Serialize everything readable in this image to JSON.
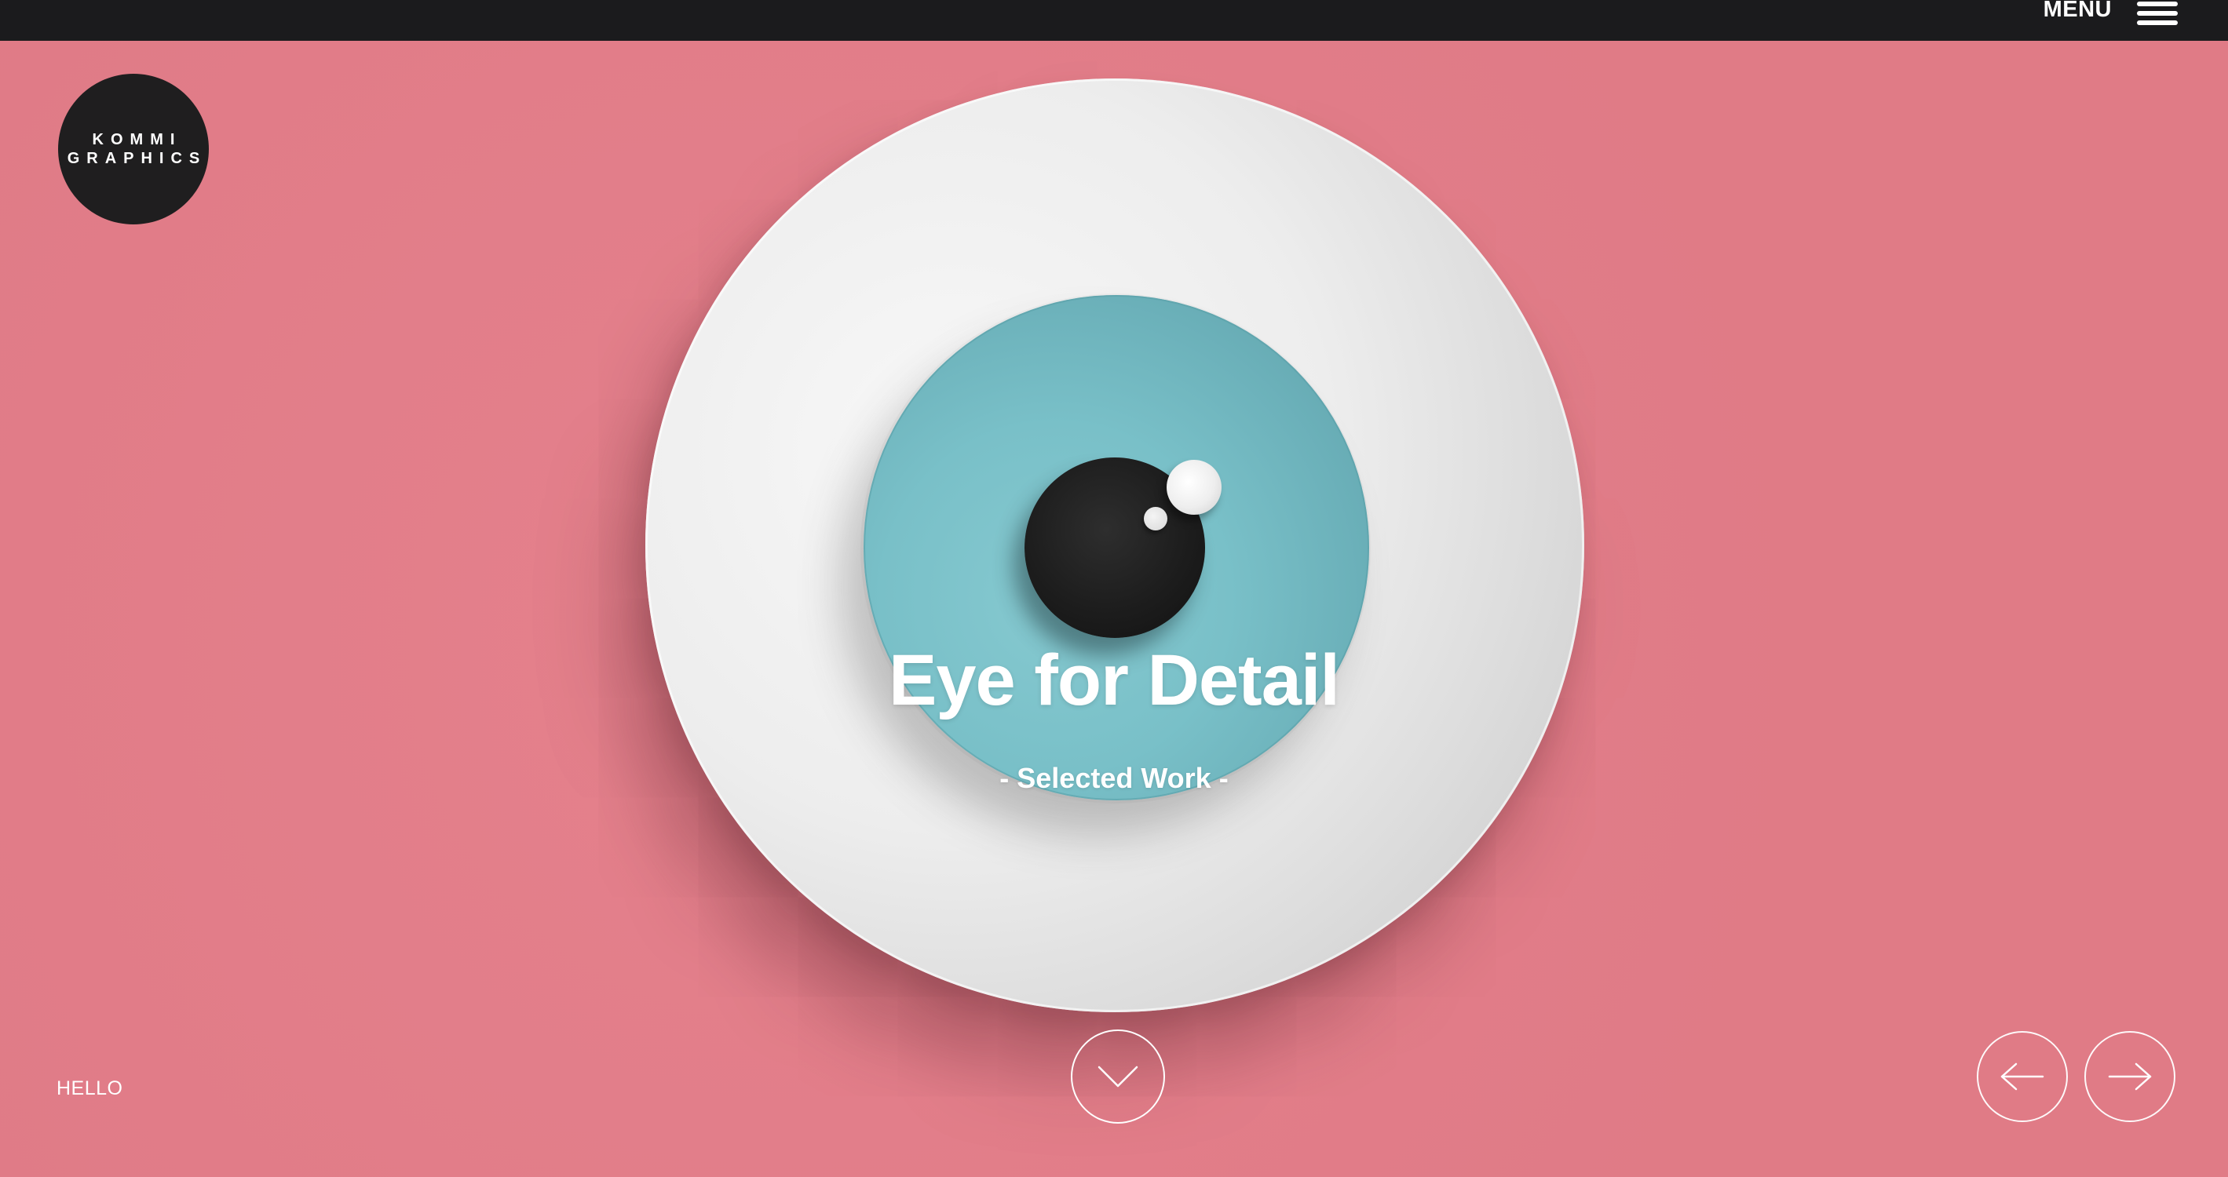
{
  "header": {
    "menu_label": "MENU",
    "menu_icon": "hamburger-menu-icon",
    "bar_color": "#1b1b1d"
  },
  "logo": {
    "line1": "KOMMI",
    "line2": "GRAPHICS"
  },
  "hero": {
    "title": "Eye for Detail",
    "subtitle": "- Selected Work -",
    "background_color": "#e47d89",
    "iris_color": "#79c0c8",
    "plate_color": "#ededed"
  },
  "footer": {
    "hello_link": "HELLO",
    "scroll_icon": "chevron-down-icon",
    "prev_icon": "arrow-left-icon",
    "next_icon": "arrow-right-icon"
  }
}
